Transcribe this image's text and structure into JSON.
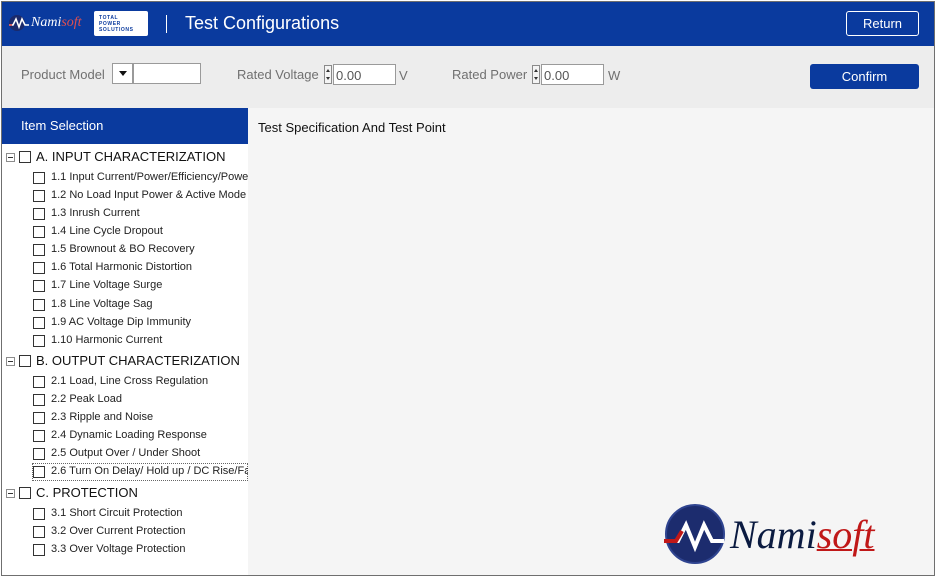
{
  "header": {
    "brand_prefix": "Nami",
    "brand_suffix": "soft",
    "tagline_lines": [
      "TOTAL",
      "POWER",
      "SOLUTIONS"
    ],
    "title": "Test Configurations",
    "return_label": "Return"
  },
  "params": {
    "product_model_label": "Product Model",
    "product_model_value": "",
    "rated_voltage_label": "Rated Voltage",
    "rated_voltage_value": "0.00",
    "rated_voltage_unit": "V",
    "rated_power_label": "Rated Power",
    "rated_power_value": "0.00",
    "rated_power_unit": "W",
    "confirm_label": "Confirm"
  },
  "left_panel": {
    "header": "Item Selection",
    "categories": [
      {
        "label": "A. INPUT CHARACTERIZATION",
        "items": [
          "1.1 Input Current/Power/Efficiency/Powe",
          "1.2 No Load Input Power & Active Mode I",
          "1.3 Inrush Current",
          "1.4 Line Cycle Dropout",
          "1.5 Brownout & BO Recovery",
          "1.6 Total Harmonic Distortion",
          "1.7 Line Voltage Surge",
          "1.8 Line Voltage Sag",
          "1.9 AC Voltage Dip Immunity",
          "1.10 Harmonic Current"
        ]
      },
      {
        "label": "B. OUTPUT CHARACTERIZATION",
        "items": [
          "2.1 Load, Line Cross Regulation",
          "2.2 Peak Load",
          "2.3 Ripple and Noise",
          "2.4 Dynamic Loading Response",
          "2.5 Output Over / Under Shoot",
          "2.6 Turn On  Delay/ Hold up / DC Rise/Fa"
        ]
      },
      {
        "label": "C. PROTECTION",
        "items": [
          "3.1 Short Circuit Protection",
          "3.2 Over Current Protection",
          "3.3 Over Voltage Protection"
        ]
      }
    ]
  },
  "right_panel": {
    "header": "Test Specification And Test Point"
  },
  "logo": {
    "prefix": "Nami",
    "suffix": "soft"
  },
  "colors": {
    "primary": "#0a3a9e",
    "panel_bg": "#ededed",
    "logo_red": "#c01818"
  }
}
